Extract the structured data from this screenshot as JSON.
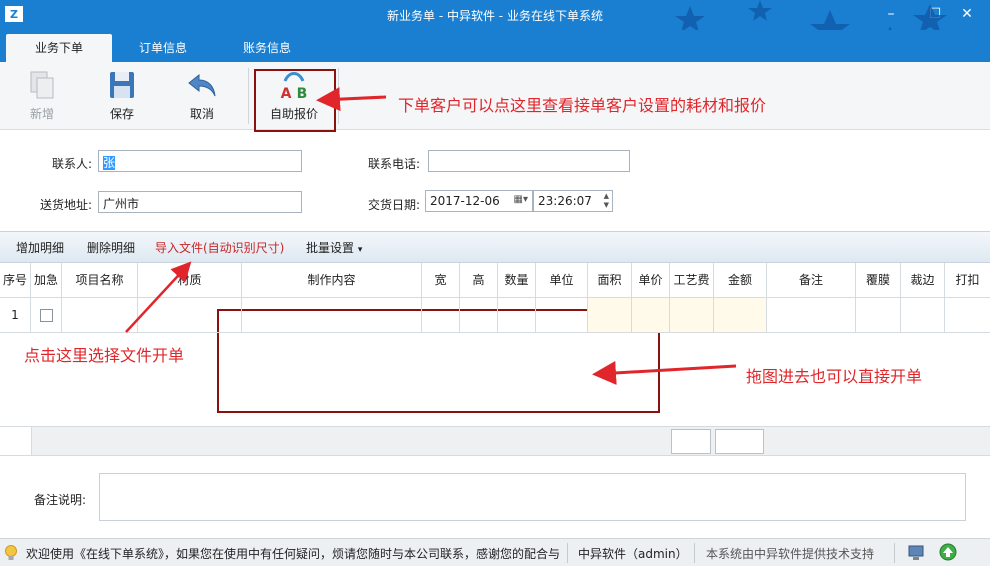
{
  "window": {
    "title": "新业务单 - 中异软件 - 业务在线下单系统"
  },
  "tabs": [
    {
      "label": "业务下单"
    },
    {
      "label": "订单信息"
    },
    {
      "label": "账务信息"
    }
  ],
  "toolbar": {
    "new_label": "新增",
    "save_label": "保存",
    "cancel_label": "取消",
    "auto_quote_label": "自助报价"
  },
  "form": {
    "contact_label": "联系人:",
    "contact_value": "张",
    "phone_label": "联系电话:",
    "phone_value": "",
    "address_label": "送货地址:",
    "address_value": "广州市",
    "delivery_date_label": "交货日期:",
    "delivery_date_value": "2017-12-06",
    "delivery_time_value": "23:26:07"
  },
  "detail_toolbar": {
    "add_label": "增加明细",
    "delete_label": "删除明细",
    "import_label": "导入文件(自动识别尺寸)",
    "batch_label": "批量设置"
  },
  "grid": {
    "columns": [
      "序号",
      "加急",
      "项目名称",
      "材质",
      "制作内容",
      "宽",
      "高",
      "数量",
      "单位",
      "面积",
      "单价",
      "工艺费",
      "金额",
      "备注",
      "覆膜",
      "裁边",
      "打扣"
    ],
    "rows": [
      {
        "index": "1"
      }
    ]
  },
  "remark": {
    "label": "备注说明:"
  },
  "annotations": {
    "auto_quote": "下单客户可以点这里查看接单客户设置的耗材和报价",
    "import_file": "点击这里选择文件开单",
    "drag_drop": "拖图进去也可以直接开单"
  },
  "statusbar": {
    "welcome": "欢迎使用《在线下单系统》，如果您在使用中有任何疑问，烦请您随时与本公司联系，感谢您的配合与",
    "user": "中异软件（admin）",
    "support": "本系统由中异软件提供技术支持"
  },
  "colors": {
    "title_blue": "#1a7fd1",
    "annotation_red": "#e0262a",
    "box_red": "#8b1010"
  }
}
